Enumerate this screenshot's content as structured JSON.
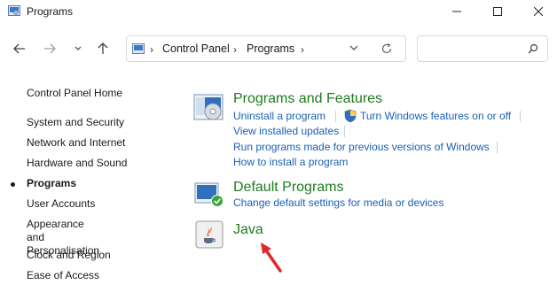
{
  "window": {
    "title": "Programs"
  },
  "address": {
    "crumbs": [
      "Control Panel",
      "Programs"
    ],
    "search_placeholder": ""
  },
  "sidebar": {
    "items": [
      {
        "label": "Control Panel Home"
      },
      {
        "label": "System and Security"
      },
      {
        "label": "Network and Internet"
      },
      {
        "label": "Hardware and Sound"
      },
      {
        "label": "Programs",
        "active": true
      },
      {
        "label": "User Accounts"
      },
      {
        "label": "Appearance and\nPersonalisation"
      },
      {
        "label": "Clock and Region"
      },
      {
        "label": "Ease of Access"
      }
    ]
  },
  "categories": {
    "programs_features": {
      "title": "Programs and Features",
      "links": [
        "Uninstall a program",
        "Turn Windows features on or off",
        "View installed updates",
        "Run programs made for previous versions of Windows",
        "How to install a program"
      ]
    },
    "default_programs": {
      "title": "Default Programs",
      "links": [
        "Change default settings for media or devices"
      ]
    },
    "java": {
      "title": "Java"
    }
  },
  "colors": {
    "category_title": "#1e7c1e",
    "link": "#1a5fb4",
    "annotation_arrow": "#e0282a"
  }
}
